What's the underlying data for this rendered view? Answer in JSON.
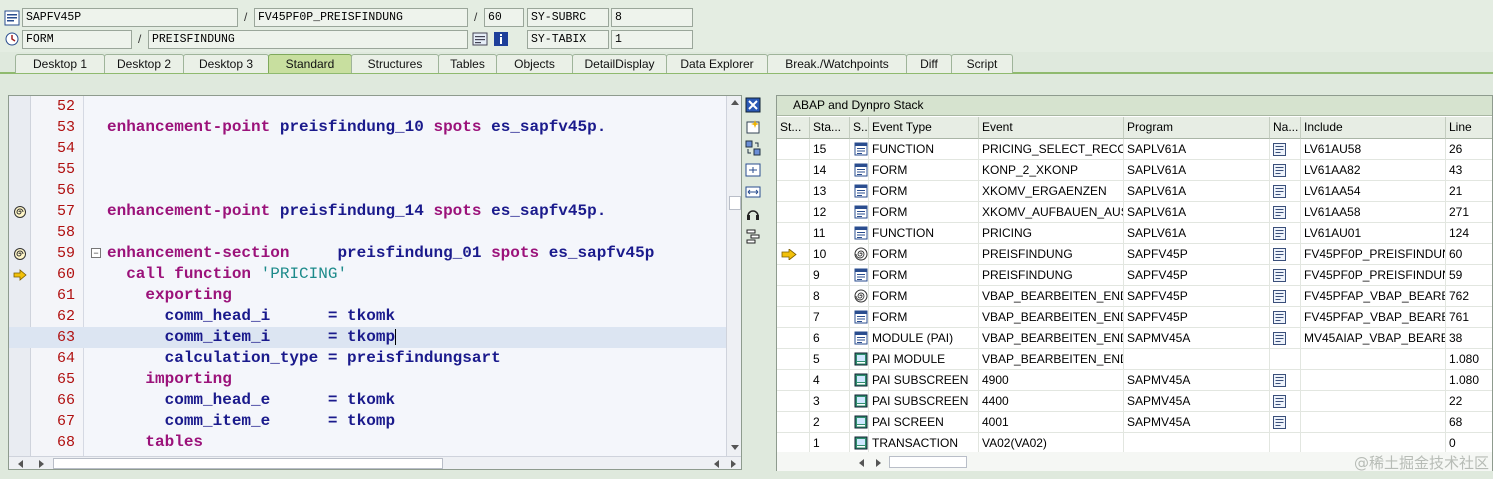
{
  "top": {
    "program": "SAPFV45P",
    "include": "FV45PF0P_PREISFINDUNG",
    "line": "60",
    "var1_name": "SY-SUBRC",
    "var1_value": "8",
    "event_type": "FORM",
    "event": "PREISFINDUNG",
    "var2_name": "SY-TABIX",
    "var2_value": "1",
    "slash1": "/",
    "slash2": "/",
    "slash3": "/"
  },
  "tabs": [
    {
      "label": "Desktop 1"
    },
    {
      "label": "Desktop 2"
    },
    {
      "label": "Desktop 3"
    },
    {
      "label": "Standard"
    },
    {
      "label": "Structures"
    },
    {
      "label": "Tables"
    },
    {
      "label": "Objects"
    },
    {
      "label": "DetailDisplay"
    },
    {
      "label": "Data Explorer"
    },
    {
      "label": "Break./Watchpoints"
    },
    {
      "label": "Diff"
    },
    {
      "label": "Script"
    }
  ],
  "active_tab": "Standard",
  "editor": {
    "lines": [
      {
        "n": "52",
        "code": ""
      },
      {
        "n": "53",
        "code": "enhancement-point preisfindung_10 spots es_sapfv45p."
      },
      {
        "n": "54",
        "code": ""
      },
      {
        "n": "55",
        "code": ""
      },
      {
        "n": "56",
        "code": ""
      },
      {
        "n": "57",
        "code": "enhancement-point preisfindung_14 spots es_sapfv45p."
      },
      {
        "n": "58",
        "code": ""
      },
      {
        "n": "59",
        "code": "enhancement-section     preisfindung_01 spots es_sapfv45p"
      },
      {
        "n": "60",
        "code": "  call function 'PRICING'"
      },
      {
        "n": "61",
        "code": "    exporting"
      },
      {
        "n": "62",
        "code": "      comm_head_i      = tkomk"
      },
      {
        "n": "63",
        "code": "      comm_item_i      = tkomp"
      },
      {
        "n": "64",
        "code": "      calculation_type = preisfindungsart"
      },
      {
        "n": "65",
        "code": "    importing"
      },
      {
        "n": "66",
        "code": "      comm_head_e      = tkomk"
      },
      {
        "n": "67",
        "code": "      comm_item_e      = tkomp"
      },
      {
        "n": "68",
        "code": "    tables"
      }
    ]
  },
  "stack": {
    "title": "ABAP and Dynpro Stack",
    "headers": [
      "St...",
      "Sta...",
      "S...",
      "Event Type",
      "Event",
      "Program",
      "Na...",
      "Include",
      "Line"
    ],
    "rows": [
      {
        "level": "15",
        "type": "FUNCTION",
        "event": "PRICING_SELECT_RECOR...",
        "program": "SAPLV61A",
        "include": "LV61AU58",
        "line": "26",
        "icon": "source-icon",
        "nav": true,
        "current": false
      },
      {
        "level": "14",
        "type": "FORM",
        "event": "KONP_2_XKONP",
        "program": "SAPLV61A",
        "include": "LV61AA82",
        "line": "43",
        "icon": "source-icon",
        "nav": true,
        "current": false
      },
      {
        "level": "13",
        "type": "FORM",
        "event": "XKOMV_ERGAENZEN",
        "program": "SAPLV61A",
        "include": "LV61AA54",
        "line": "21",
        "icon": "source-icon",
        "nav": true,
        "current": false
      },
      {
        "level": "12",
        "type": "FORM",
        "event": "XKOMV_AUFBAUEN_AUS...",
        "program": "SAPLV61A",
        "include": "LV61AA58",
        "line": "271",
        "icon": "source-icon",
        "nav": true,
        "current": false
      },
      {
        "level": "11",
        "type": "FUNCTION",
        "event": "PRICING",
        "program": "SAPLV61A",
        "include": "LV61AU01",
        "line": "124",
        "icon": "source-icon",
        "nav": true,
        "current": false
      },
      {
        "level": "10",
        "type": "FORM",
        "event": "PREISFINDUNG",
        "program": "SAPFV45P",
        "include": "FV45PF0P_PREISFINDUNG",
        "line": "60",
        "icon": "spiral-icon",
        "nav": true,
        "current": true
      },
      {
        "level": "9",
        "type": "FORM",
        "event": "PREISFINDUNG",
        "program": "SAPFV45P",
        "include": "FV45PF0P_PREISFINDUNG",
        "line": "59",
        "icon": "source-icon",
        "nav": true,
        "current": false
      },
      {
        "level": "8",
        "type": "FORM",
        "event": "VBAP_BEARBEITEN_ENDE",
        "program": "SAPFV45P",
        "include": "FV45PFAP_VBAP_BEARB...",
        "line": "762",
        "icon": "spiral-icon",
        "nav": true,
        "current": false
      },
      {
        "level": "7",
        "type": "FORM",
        "event": "VBAP_BEARBEITEN_ENDE",
        "program": "SAPFV45P",
        "include": "FV45PFAP_VBAP_BEARB...",
        "line": "761",
        "icon": "source-icon",
        "nav": true,
        "current": false
      },
      {
        "level": "6",
        "type": "MODULE (PAI)",
        "event": "VBAP_BEARBEITEN_ENDE",
        "program": "SAPMV45A",
        "include": "MV45AIAP_VBAP_BEARB...",
        "line": "38",
        "icon": "source-icon",
        "nav": true,
        "current": false
      },
      {
        "level": "5",
        "type": "PAI MODULE",
        "event": "VBAP_BEARBEITEN_ENDE",
        "program": "",
        "include": "",
        "line": "1.080",
        "icon": "screen-icon",
        "nav": false,
        "current": false
      },
      {
        "level": "4",
        "type": "PAI SUBSCREEN",
        "event": "4900",
        "program": "SAPMV45A",
        "include": "",
        "line": "1.080",
        "icon": "screen-icon",
        "nav": true,
        "current": false
      },
      {
        "level": "3",
        "type": "PAI SUBSCREEN",
        "event": "4400",
        "program": "SAPMV45A",
        "include": "",
        "line": "22",
        "icon": "screen-icon",
        "nav": true,
        "current": false
      },
      {
        "level": "2",
        "type": "PAI SCREEN",
        "event": "4001",
        "program": "SAPMV45A",
        "include": "",
        "line": "68",
        "icon": "screen-icon",
        "nav": true,
        "current": false
      },
      {
        "level": "1",
        "type": "TRANSACTION",
        "event": "VA02(VA02)",
        "program": "",
        "include": "",
        "line": "0",
        "icon": "screen-icon",
        "nav": false,
        "current": false
      }
    ]
  },
  "watermark": "@稀土掘金技术社区"
}
